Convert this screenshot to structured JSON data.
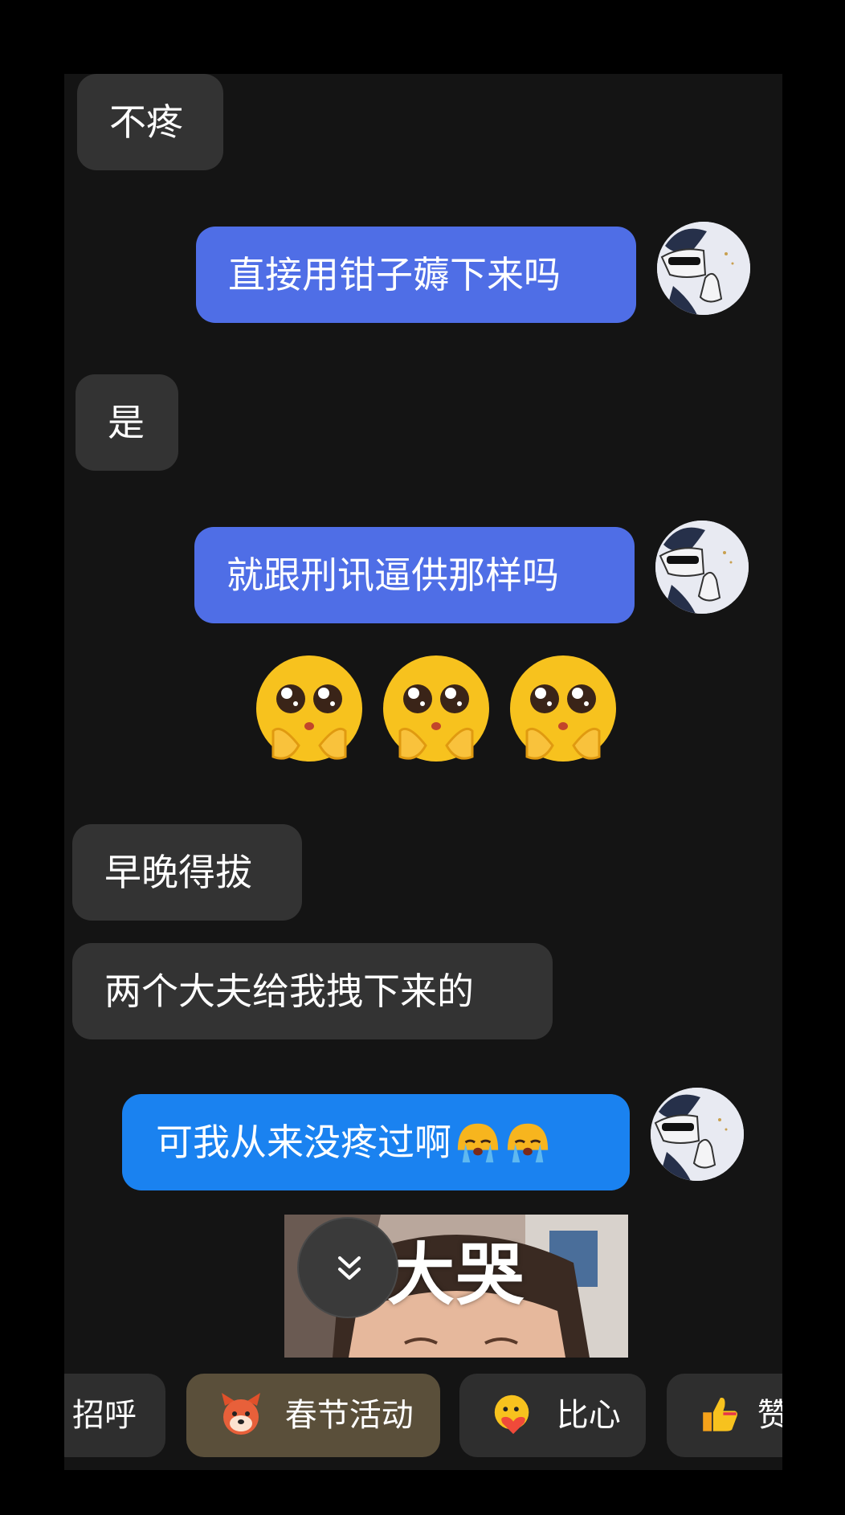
{
  "messages": [
    {
      "side": "in",
      "text": "不疼"
    },
    {
      "side": "out",
      "text": "直接用钳子薅下来吗"
    },
    {
      "side": "in",
      "text": "是"
    },
    {
      "side": "out",
      "text": "就跟刑讯逼供那样吗"
    },
    {
      "side": "out",
      "type": "emoji",
      "icons": [
        "pleading-hands-emoji",
        "pleading-hands-emoji",
        "pleading-hands-emoji"
      ]
    },
    {
      "side": "in",
      "text": "早晚得拔"
    },
    {
      "side": "in",
      "text": "两个大夫给我拽下来的"
    },
    {
      "side": "out",
      "text": "可我从来没疼过啊",
      "trailing_icons": [
        "crying-emoji",
        "crying-emoji"
      ]
    },
    {
      "side": "out",
      "type": "sticker",
      "caption": "大哭"
    }
  ],
  "quick_actions": [
    {
      "label": "打招呼",
      "visible_label": "招呼",
      "icon": "wave-icon"
    },
    {
      "label": "春节活动",
      "icon": "festival-mascot-icon"
    },
    {
      "label": "比心",
      "icon": "heart-hands-icon"
    },
    {
      "label": "赞",
      "visible_label": "赞",
      "icon": "thumbs-up-icon"
    }
  ],
  "colors": {
    "background": "#141414",
    "incoming_bubble": "#333333",
    "outgoing_bubble": "#4f6ee6",
    "outgoing_bubble_alt": "#1a82f0",
    "chip": "#2e2e2e",
    "festival_chip": "#5a4f3a"
  }
}
